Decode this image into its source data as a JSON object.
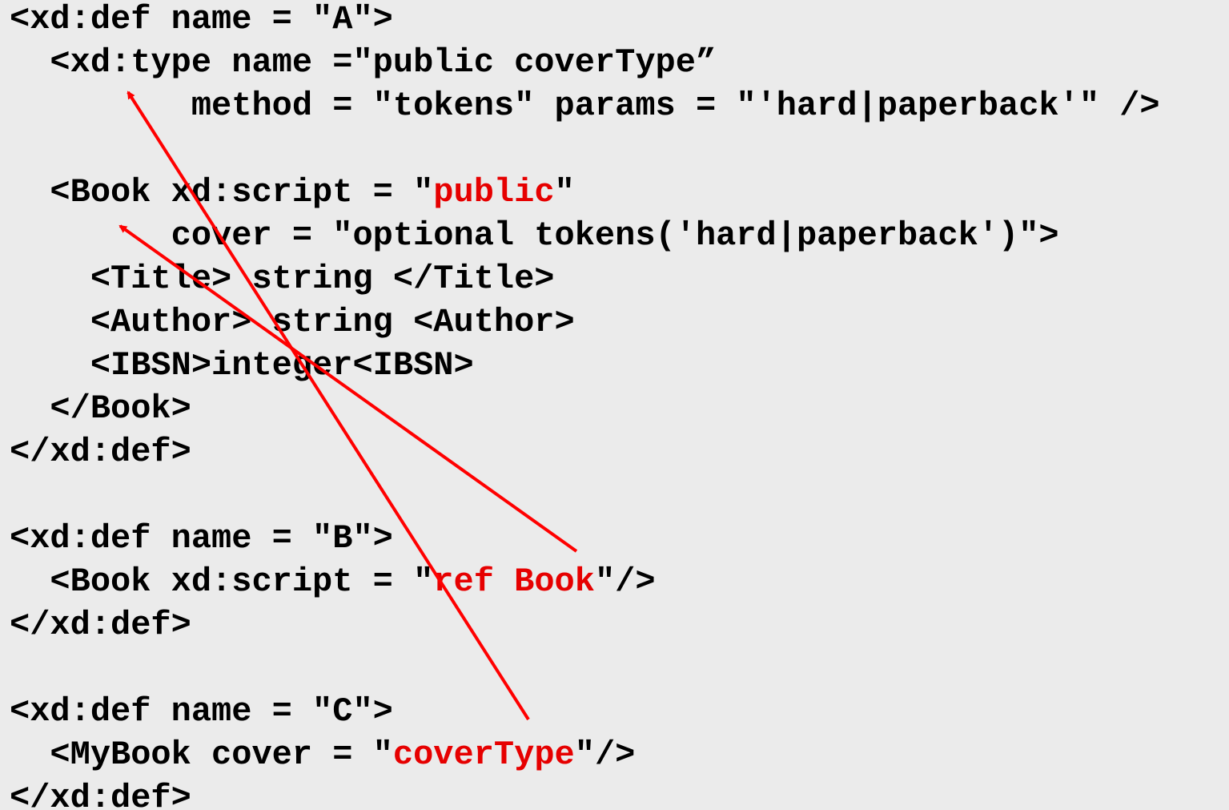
{
  "colors": {
    "background": "#ebebeb",
    "text": "#000000",
    "highlight": "#e60000",
    "arrow": "#ff0000"
  },
  "code": {
    "line_01": "<xd:def name = \"A\">",
    "line_02": "  <xd:type name =\"public coverType”",
    "line_03": "         method = \"tokens\" params = \"'hard|paperback'\" />",
    "line_05_a": "  <Book xd:script = \"",
    "line_05_hl": "public",
    "line_05_b": "\"",
    "line_06": "        cover = \"optional tokens('hard|paperback')\">",
    "line_07": "    <Title> string </Title>",
    "line_08": "    <Author> string <Author>",
    "line_09": "    <IBSN>integer<IBSN>",
    "line_10": "  </Book>",
    "line_11": "</xd:def>",
    "line_13": "<xd:def name = \"B\">",
    "line_14_a": "  <Book xd:script = \"",
    "line_14_hl": "ref Book",
    "line_14_b": "\"/>",
    "line_15": "</xd:def>",
    "line_17": "<xd:def name = \"C\">",
    "line_18_a": "  <MyBook cover = \"",
    "line_18_hl": "coverType",
    "line_18_b": "\"/>",
    "line_19": "</xd:def>"
  },
  "arrows": [
    {
      "id": "ref-book-to-book",
      "from": "ref Book",
      "to": "<Book"
    },
    {
      "id": "covertype-to-type",
      "from": "coverType",
      "to": "<xd:type"
    }
  ]
}
